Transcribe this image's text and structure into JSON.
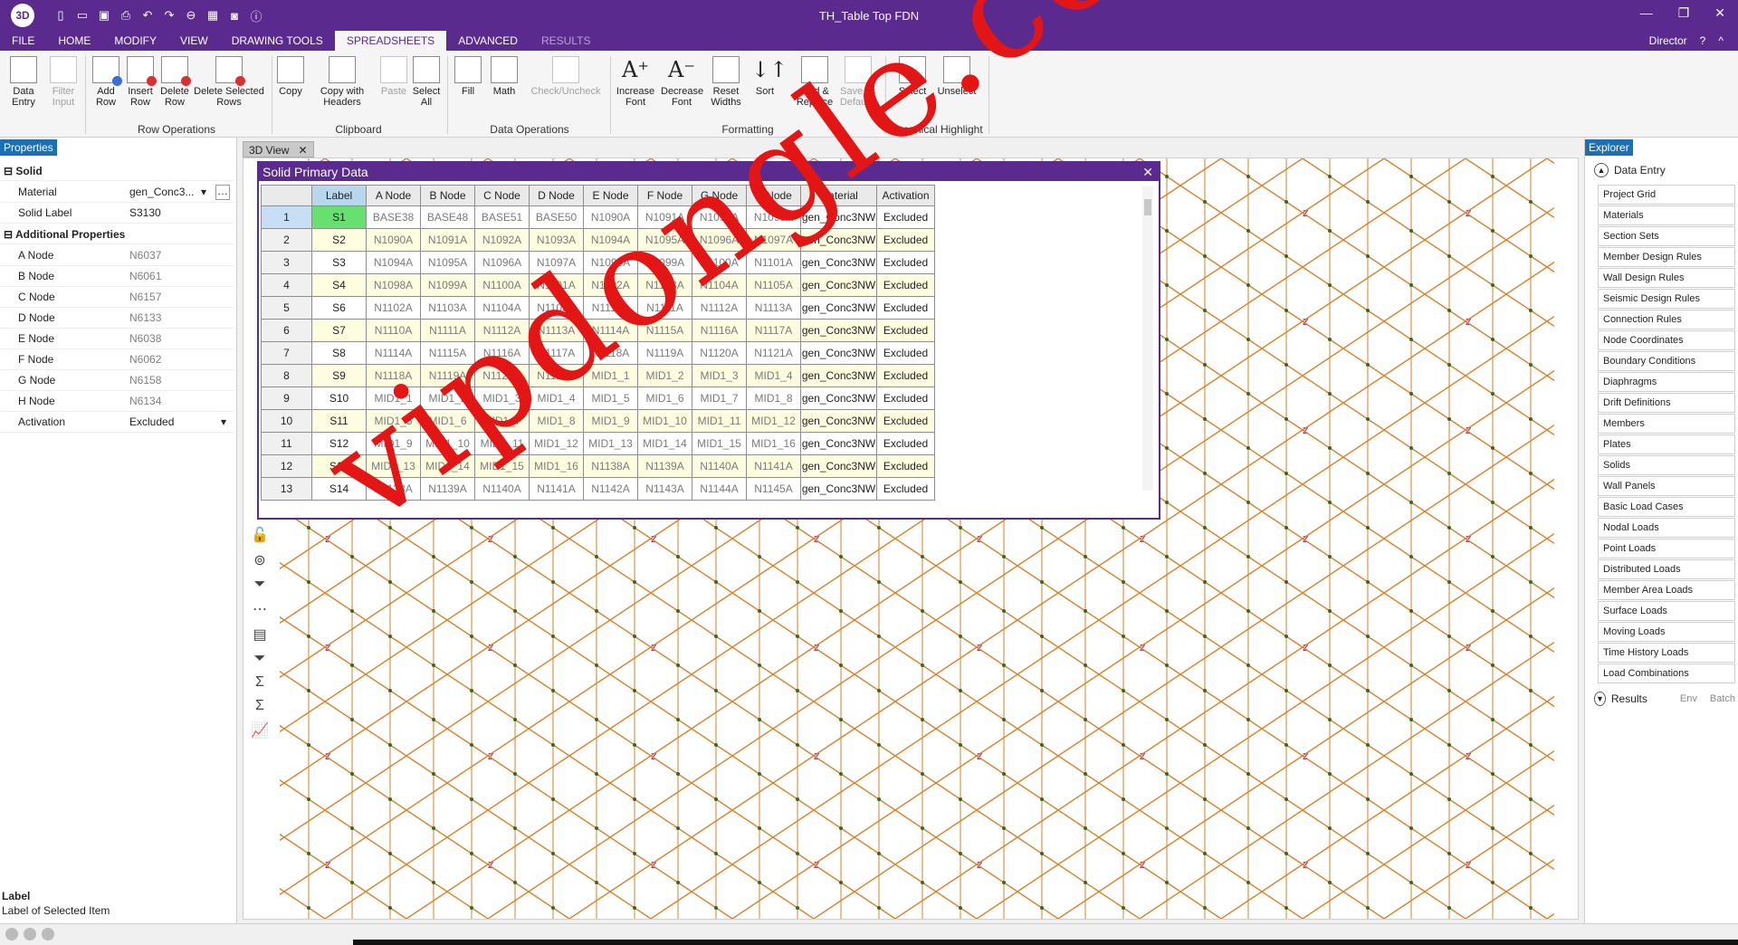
{
  "app": {
    "logo": "3D",
    "title": "TH_Table Top FDN",
    "user": "Director",
    "help": "?",
    "qat_icons": [
      "new-file-icon",
      "open-folder-icon",
      "save-icon",
      "print-icon",
      "undo-icon",
      "redo-icon",
      "minus-circle-icon",
      "grid-icon",
      "camera-icon",
      "info-icon"
    ]
  },
  "menu": {
    "tabs": [
      {
        "label": "FILE",
        "state": "normal"
      },
      {
        "label": "HOME",
        "state": "normal"
      },
      {
        "label": "MODIFY",
        "state": "normal"
      },
      {
        "label": "VIEW",
        "state": "normal"
      },
      {
        "label": "DRAWING TOOLS",
        "state": "normal"
      },
      {
        "label": "SPREADSHEETS",
        "state": "active"
      },
      {
        "label": "ADVANCED",
        "state": "normal"
      },
      {
        "label": "RESULTS",
        "state": "disabled"
      }
    ]
  },
  "ribbon": {
    "buttons": {
      "data_entry": "Data Entry",
      "filter_input": "Filter Input",
      "add_row": "Add Row",
      "insert_row": "Insert Row",
      "delete_row": "Delete Row",
      "delete_selected_rows": "Delete Selected Rows",
      "copy": "Copy",
      "copy_with_headers": "Copy with Headers",
      "paste": "Paste",
      "select_all": "Select All",
      "fill": "Fill",
      "math": "Math",
      "check_uncheck": "Check/Uncheck",
      "increase_font": "Increase Font",
      "decrease_font": "Decrease Font",
      "reset_widths": "Reset Widths",
      "sort": "Sort",
      "find_replace": "Find & Replace",
      "save_defaults": "Save as Defaults",
      "select": "Select",
      "unselect": "Unselect"
    },
    "groups": {
      "row_operations": "Row Operations",
      "clipboard": "Clipboard",
      "data_operations": "Data Operations",
      "formatting": "Formatting",
      "graphical_highlight": "Graphical Highlight"
    }
  },
  "properties": {
    "tab": "Properties",
    "section_solid": "Solid",
    "material_label": "Material",
    "material_value": "gen_Conc3...",
    "solid_label_label": "Solid Label",
    "solid_label_value": "S3130",
    "section_additional": "Additional Properties",
    "nodes": [
      {
        "k": "A Node",
        "v": "N6037"
      },
      {
        "k": "B Node",
        "v": "N6061"
      },
      {
        "k": "C Node",
        "v": "N6157"
      },
      {
        "k": "D Node",
        "v": "N6133"
      },
      {
        "k": "E Node",
        "v": "N6038"
      },
      {
        "k": "F Node",
        "v": "N6062"
      },
      {
        "k": "G Node",
        "v": "N6158"
      },
      {
        "k": "H Node",
        "v": "N6134"
      }
    ],
    "activation_label": "Activation",
    "activation_value": "Excluded",
    "desc_title": "Label",
    "desc_text": "Label of Selected Item"
  },
  "view": {
    "tab": "3D View"
  },
  "datawin": {
    "title": "Solid Primary Data",
    "columns": [
      "Label",
      "A Node",
      "B Node",
      "C Node",
      "D Node",
      "E Node",
      "F Node",
      "G Node",
      "H Node",
      "Material",
      "Activation"
    ],
    "rows": [
      {
        "n": "1",
        "cells": [
          "S1",
          "BASE38",
          "BASE48",
          "BASE51",
          "BASE50",
          "N1090A",
          "N1091A",
          "N1092A",
          "N1093A",
          "gen_Conc3NW",
          "Excluded"
        ]
      },
      {
        "n": "2",
        "cells": [
          "S2",
          "N1090A",
          "N1091A",
          "N1092A",
          "N1093A",
          "N1094A",
          "N1095A",
          "N1096A",
          "N1097A",
          "gen_Conc3NW",
          "Excluded"
        ]
      },
      {
        "n": "3",
        "cells": [
          "S3",
          "N1094A",
          "N1095A",
          "N1096A",
          "N1097A",
          "N1098A",
          "N1099A",
          "N1100A",
          "N1101A",
          "gen_Conc3NW",
          "Excluded"
        ]
      },
      {
        "n": "4",
        "cells": [
          "S4",
          "N1098A",
          "N1099A",
          "N1100A",
          "N1101A",
          "N1102A",
          "N1103A",
          "N1104A",
          "N1105A",
          "gen_Conc3NW",
          "Excluded"
        ]
      },
      {
        "n": "5",
        "cells": [
          "S6",
          "N1102A",
          "N1103A",
          "N1104A",
          "N1105A",
          "N1110A",
          "N1111A",
          "N1112A",
          "N1113A",
          "gen_Conc3NW",
          "Excluded"
        ]
      },
      {
        "n": "6",
        "cells": [
          "S7",
          "N1110A",
          "N1111A",
          "N1112A",
          "N1113A",
          "N1114A",
          "N1115A",
          "N1116A",
          "N1117A",
          "gen_Conc3NW",
          "Excluded"
        ]
      },
      {
        "n": "7",
        "cells": [
          "S8",
          "N1114A",
          "N1115A",
          "N1116A",
          "N1117A",
          "N1118A",
          "N1119A",
          "N1120A",
          "N1121A",
          "gen_Conc3NW",
          "Excluded"
        ]
      },
      {
        "n": "8",
        "cells": [
          "S9",
          "N1118A",
          "N1119A",
          "N1120A",
          "N1121A",
          "MID1_1",
          "MID1_2",
          "MID1_3",
          "MID1_4",
          "gen_Conc3NW",
          "Excluded"
        ]
      },
      {
        "n": "9",
        "cells": [
          "S10",
          "MID1_1",
          "MID1_2",
          "MID1_3",
          "MID1_4",
          "MID1_5",
          "MID1_6",
          "MID1_7",
          "MID1_8",
          "gen_Conc3NW",
          "Excluded"
        ]
      },
      {
        "n": "10",
        "cells": [
          "S11",
          "MID1_5",
          "MID1_6",
          "MID1_7",
          "MID1_8",
          "MID1_9",
          "MID1_10",
          "MID1_11",
          "MID1_12",
          "gen_Conc3NW",
          "Excluded"
        ]
      },
      {
        "n": "11",
        "cells": [
          "S12",
          "MID1_9",
          "MID1_10",
          "MID1_11",
          "MID1_12",
          "MID1_13",
          "MID1_14",
          "MID1_15",
          "MID1_16",
          "gen_Conc3NW",
          "Excluded"
        ]
      },
      {
        "n": "12",
        "cells": [
          "S13",
          "MID1_13",
          "MID1_14",
          "MID1_15",
          "MID1_16",
          "N1138A",
          "N1139A",
          "N1140A",
          "N1141A",
          "gen_Conc3NW",
          "Excluded"
        ]
      },
      {
        "n": "13",
        "cells": [
          "S14",
          "N1138A",
          "N1139A",
          "N1140A",
          "N1141A",
          "N1142A",
          "N1143A",
          "N1144A",
          "N1145A",
          "gen_Conc3NW",
          "Excluded"
        ]
      }
    ]
  },
  "explorer": {
    "tab": "Explorer",
    "header": "Data Entry",
    "items": [
      "Project Grid",
      "Materials",
      "Section Sets",
      "Member Design Rules",
      "Wall Design Rules",
      "Seismic Design Rules",
      "Connection Rules",
      "Node Coordinates",
      "Boundary Conditions",
      "Diaphragms",
      "Drift Definitions",
      "Members",
      "Plates",
      "Solids",
      "Wall Panels",
      "Basic Load Cases",
      "Nodal Loads",
      "Point Loads",
      "Distributed Loads",
      "Member Area Loads",
      "Surface Loads",
      "Moving Loads",
      "Time History Loads",
      "Load Combinations"
    ],
    "results": "Results",
    "env": "Env",
    "batch": "Batch"
  },
  "watermark": "vipdongle.com",
  "colors": {
    "accent": "#5b2a8e",
    "selected_label": "#67e070",
    "watermark": "#e41515",
    "member_orange": "#d9822b"
  }
}
